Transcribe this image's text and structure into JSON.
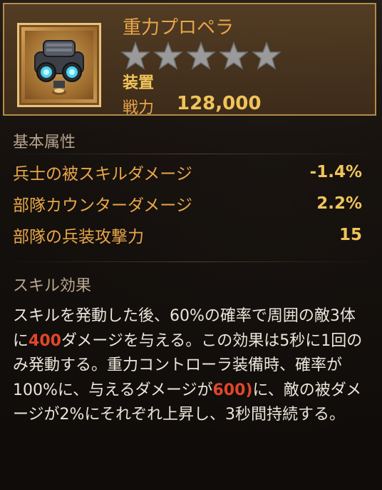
{
  "item": {
    "name": "重力プロペラ",
    "stars_total": 5,
    "stars_filled": 0,
    "category": "装置",
    "power_label": "戦力",
    "power_value": "128,000"
  },
  "sections": {
    "basic_title": "基本属性",
    "skill_title": "スキル効果"
  },
  "stats": [
    {
      "label": "兵士の被スキルダメージ",
      "value": "-1.4%"
    },
    {
      "label": "部隊カウンターダメージ",
      "value": "2.2%"
    },
    {
      "label": "部隊の兵装攻撃力",
      "value": "15"
    }
  ],
  "description": {
    "p1": "スキルを発動した後、60%の確率で周囲の敵3体に",
    "hl1": "400",
    "p2": "ダメージを与える。この効果は5秒に1回のみ発動する。重力コントローラ装備時、確率が100%に、与えるダメージが",
    "hl2": "600)",
    "p3": "に、敵の被ダメージが2%にそれぞれ上昇し、3秒間持続する。"
  },
  "colors": {
    "title": "#e8a64a",
    "value": "#f0c45a",
    "highlight": "#e0462a",
    "frame": "#b58a4a"
  },
  "icons": [
    "gravity-propeller-device-icon",
    "star-icon"
  ]
}
